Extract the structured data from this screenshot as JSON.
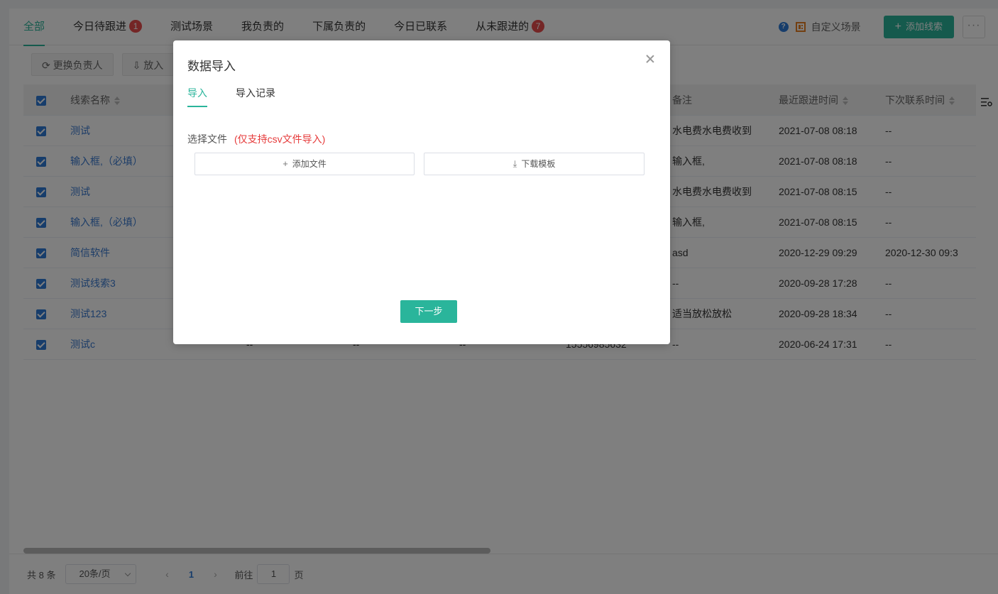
{
  "top_tabs": [
    {
      "label": "全部",
      "badge": ""
    },
    {
      "label": "今日待跟进",
      "badge": "1"
    },
    {
      "label": "测试场景",
      "badge": ""
    },
    {
      "label": "我负责的",
      "badge": ""
    },
    {
      "label": "下属负责的",
      "badge": ""
    },
    {
      "label": "今日已联系",
      "badge": ""
    },
    {
      "label": "从未跟进的",
      "badge": "7"
    }
  ],
  "actions": {
    "custom_scene": "自定义场景",
    "add_lead": "添加线索",
    "more": "···"
  },
  "toolbar": {
    "change_owner": "更换负责人",
    "put_in": "放入"
  },
  "table": {
    "headers": {
      "name": "线索名称",
      "note": "备注",
      "last_follow": "最近跟进时间",
      "next_contact": "下次联系时间"
    },
    "rows": [
      {
        "name": "测试",
        "a": "",
        "b": "",
        "c": "",
        "phone": "",
        "note": "水电费水电费收到",
        "last": "2021-07-08 08:18",
        "next": "--"
      },
      {
        "name": "输入框,（必填）",
        "a": "",
        "b": "",
        "c": "",
        "phone": "",
        "note": "输入框,",
        "last": "2021-07-08 08:18",
        "next": "--"
      },
      {
        "name": "测试",
        "a": "",
        "b": "",
        "c": "",
        "phone": "",
        "note": "水电费水电费收到",
        "last": "2021-07-08 08:15",
        "next": "--"
      },
      {
        "name": "输入框,（必填）",
        "a": "",
        "b": "",
        "c": "",
        "phone": "",
        "note": "输入框,",
        "last": "2021-07-08 08:15",
        "next": "--"
      },
      {
        "name": "简信软件",
        "a": "",
        "b": "",
        "c": "",
        "phone": "",
        "note": "asd",
        "last": "2020-12-29 09:29",
        "next": "2020-12-30 09:3"
      },
      {
        "name": "测试线索3",
        "a": "",
        "b": "",
        "c": "",
        "phone": "",
        "note": "--",
        "last": "2020-09-28 17:28",
        "next": "--"
      },
      {
        "name": "测试123",
        "a": "",
        "b": "",
        "c": "",
        "phone": "",
        "note": "适当放松放松",
        "last": "2020-09-28 18:34",
        "next": "--"
      },
      {
        "name": "测试c",
        "a": "--",
        "b": "--",
        "c": "--",
        "phone": "15556985632",
        "note": "--",
        "last": "2020-06-24 17:31",
        "next": "--"
      }
    ]
  },
  "pager": {
    "total": "共 8 条",
    "page_size": "20条/页",
    "prev": "‹",
    "current": "1",
    "next": "›",
    "goto_label": "前往",
    "goto_value": "1",
    "page_unit": "页"
  },
  "dialog": {
    "title": "数据导入",
    "tabs": [
      "导入",
      "导入记录"
    ],
    "select_file_label": "选择文件",
    "hint": "(仅支持csv文件导入)",
    "add_file": "添加文件",
    "download_template": "下载模板",
    "next_step": "下一步"
  },
  "colors": {
    "accent": "#2ab59b",
    "link": "#3a7ad1",
    "badge": "#e84c4c",
    "hint": "#e63b3b"
  }
}
